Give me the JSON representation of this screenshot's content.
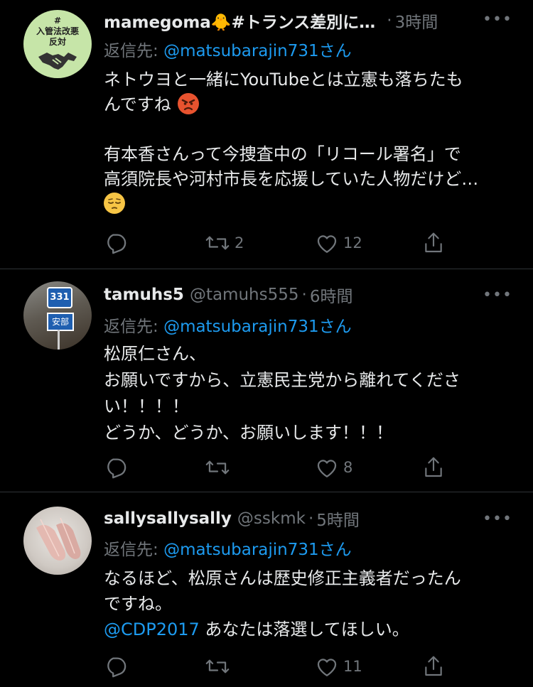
{
  "tweets": [
    {
      "name": "mamegoma🐥#トランス差別に…",
      "handle": "",
      "dot": "·",
      "time": "3時間",
      "reply_prefix": "返信先: ",
      "reply_to": "@matsubarajin731さん",
      "avatar_lines": [
        "#",
        "入管法改悪",
        "反対"
      ],
      "body_1": "ネトウヨと一緒にYouTubeとは立憲も落ちたも",
      "body_2": "んですね",
      "body_3": "有本香さんって今捜査中の「リコール署名」で",
      "body_4": "高須院長や河村市長を応援していた人物だけど…",
      "retweets": "2",
      "likes": "12"
    },
    {
      "name": "tamuhs5",
      "handle": "@tamuhs555",
      "dot": "·",
      "time": "6時間",
      "reply_prefix": "返信先: ",
      "reply_to": "@matsubarajin731さん",
      "avatar_sign_number": "331",
      "avatar_sign_text": "安部",
      "body_1": "松原仁さん、",
      "body_2": "お願いですから、立憲民主党から離れてくださ",
      "body_3": "い！！！！",
      "body_4": "どうか、どうか、お願いします！！！",
      "retweets": "",
      "likes": "8"
    },
    {
      "name": "sallysallysally",
      "handle": "@sskmk",
      "dot": "·",
      "time": "5時間",
      "reply_prefix": "返信先: ",
      "reply_to": "@matsubarajin731さん",
      "body_1": "なるほど、松原さんは歴史修正主義者だったん",
      "body_2": "ですね。",
      "mention": "@CDP2017",
      "body_3": " あなたは落選してほしい。",
      "retweets": "",
      "likes": "11"
    }
  ]
}
